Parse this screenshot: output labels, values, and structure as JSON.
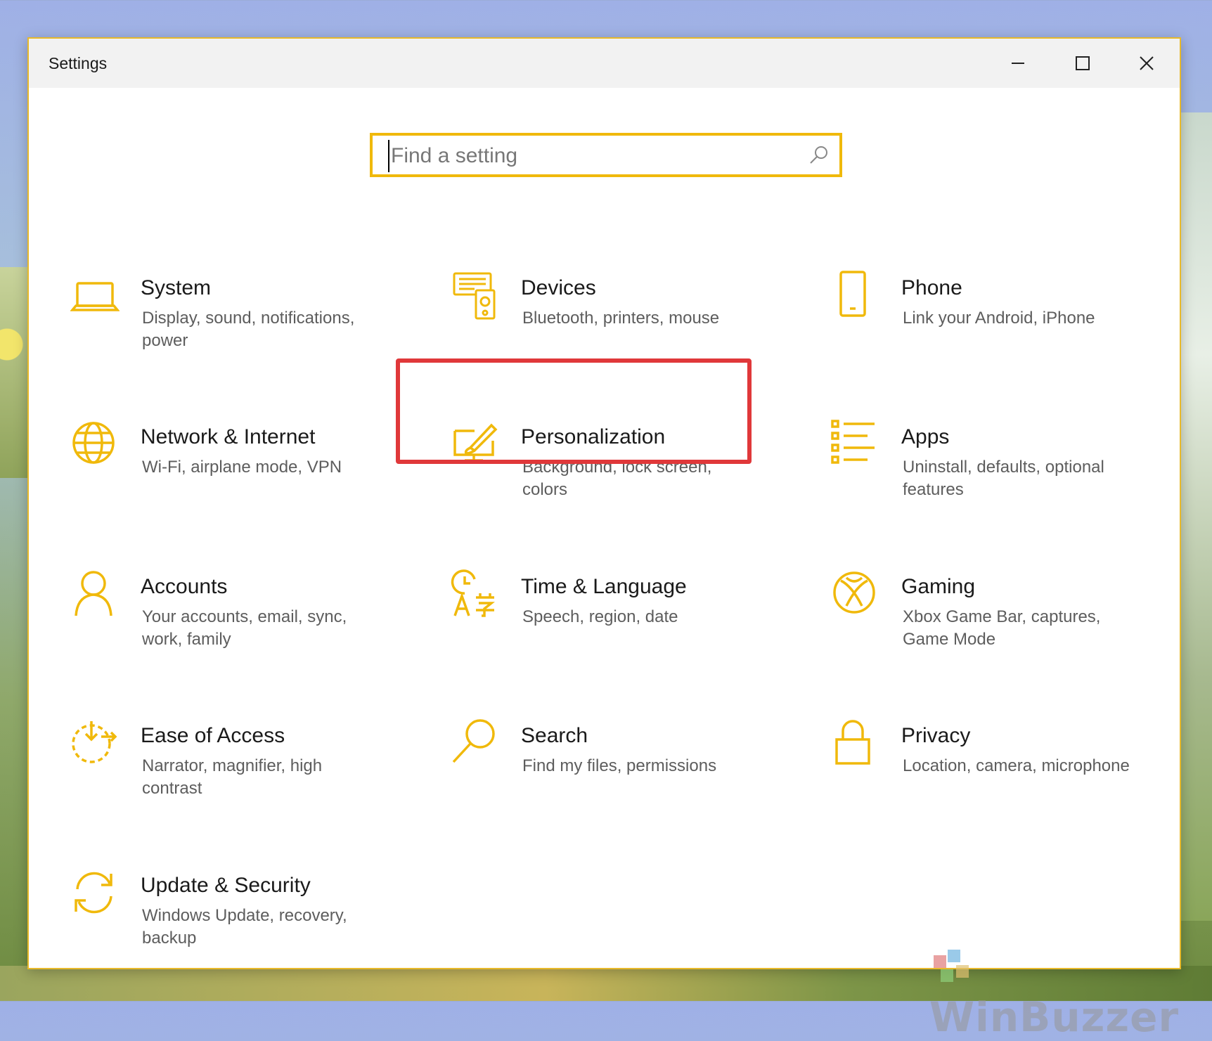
{
  "window": {
    "title": "Settings"
  },
  "search": {
    "placeholder": "Find a setting"
  },
  "accent_color": "#f0b90b",
  "highlight_color": "#e0383a",
  "tiles": [
    {
      "name": "System",
      "desc": "Display, sound, notifications, power",
      "icon": "laptop-icon"
    },
    {
      "name": "Devices",
      "desc": "Bluetooth, printers, mouse",
      "icon": "keyboard-speaker-icon"
    },
    {
      "name": "Phone",
      "desc": "Link your Android, iPhone",
      "icon": "phone-icon"
    },
    {
      "name": "Network & Internet",
      "desc": "Wi-Fi, airplane mode, VPN",
      "icon": "globe-icon"
    },
    {
      "name": "Personalization",
      "desc": "Background, lock screen, colors",
      "icon": "paintbrush-monitor-icon"
    },
    {
      "name": "Apps",
      "desc": "Uninstall, defaults, optional features",
      "icon": "list-icon"
    },
    {
      "name": "Accounts",
      "desc": "Your accounts, email, sync, work, family",
      "icon": "person-icon"
    },
    {
      "name": "Time & Language",
      "desc": "Speech, region, date",
      "icon": "clock-language-icon"
    },
    {
      "name": "Gaming",
      "desc": "Xbox Game Bar, captures, Game Mode",
      "icon": "xbox-icon"
    },
    {
      "name": "Ease of Access",
      "desc": "Narrator, magnifier, high contrast",
      "icon": "ease-of-access-icon"
    },
    {
      "name": "Search",
      "desc": "Find my files, permissions",
      "icon": "magnifier-icon"
    },
    {
      "name": "Privacy",
      "desc": "Location, camera, microphone",
      "icon": "lock-icon"
    },
    {
      "name": "Update & Security",
      "desc": "Windows Update, recovery, backup",
      "icon": "sync-arrows-icon"
    }
  ],
  "watermark": {
    "text": "WinBuzzer"
  }
}
